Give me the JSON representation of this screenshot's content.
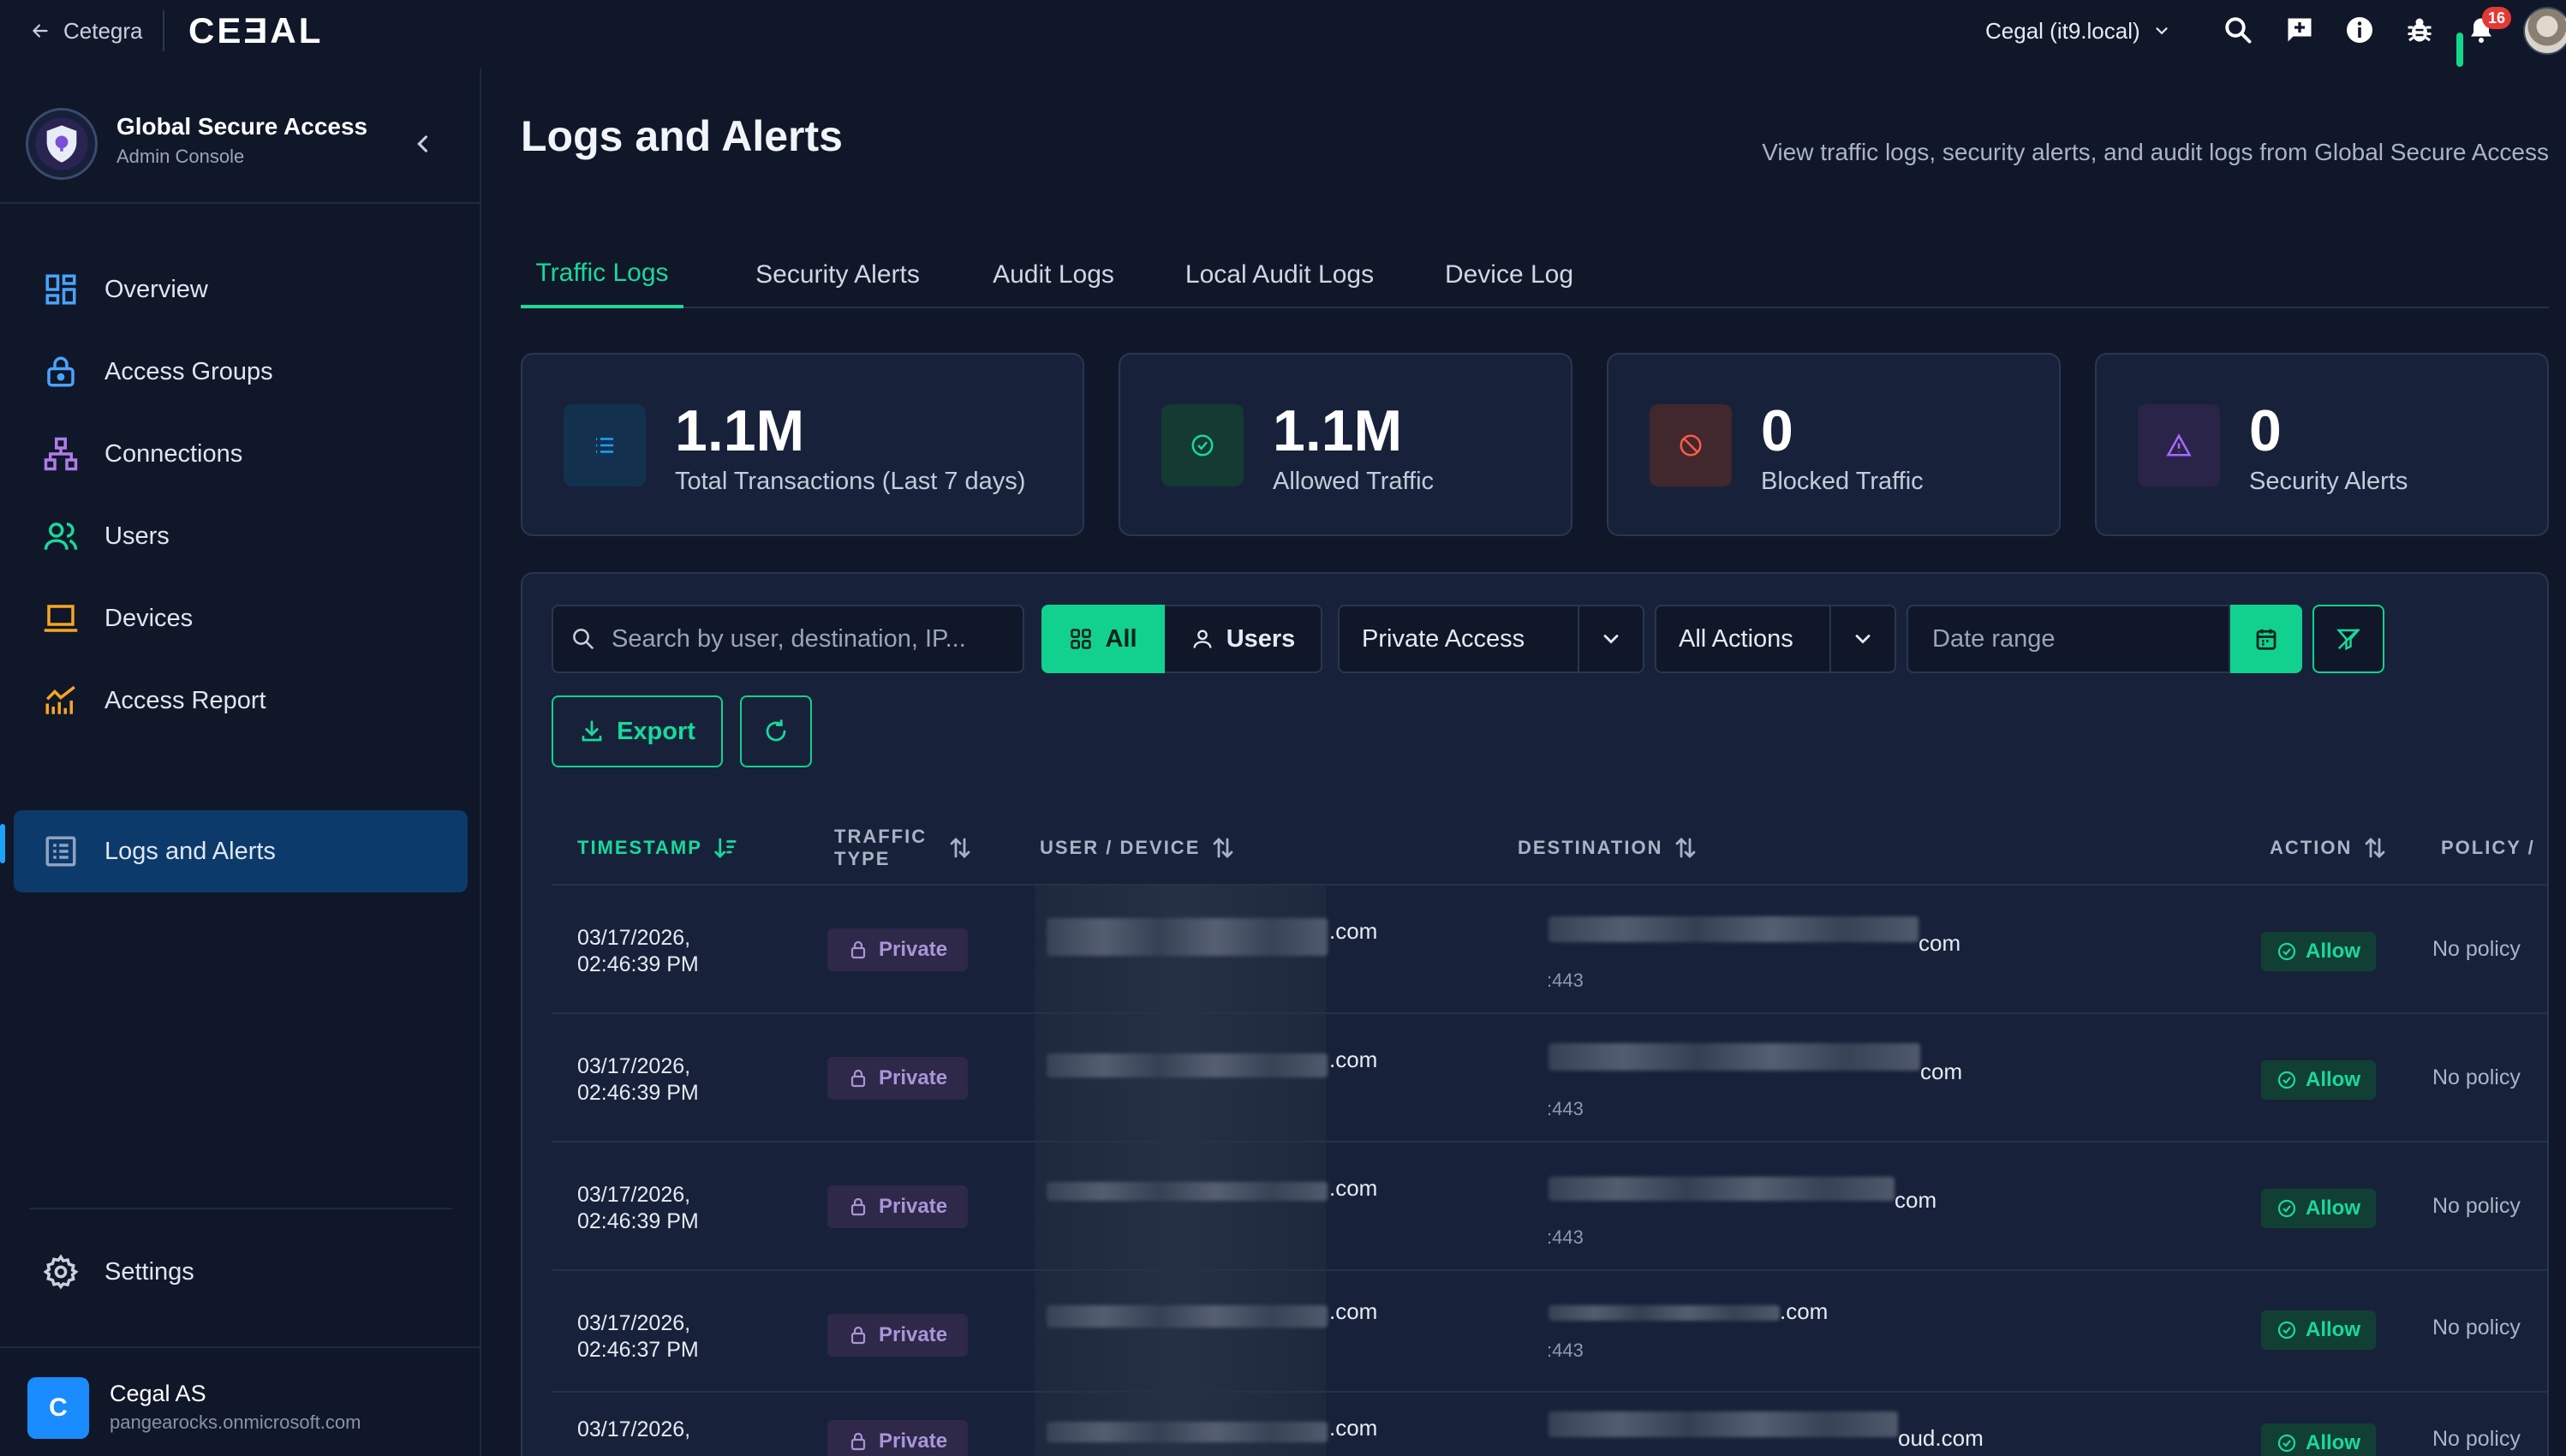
{
  "topbar": {
    "back_label": "Cetegra",
    "logo": "CEƎAL",
    "tenant": "Cegal (it9.local)",
    "notification_count": "16",
    "icons": [
      "arrow-left-icon",
      "chevron-down-icon",
      "search-icon",
      "feedback-icon",
      "info-icon",
      "bug-icon",
      "bell-icon",
      "user-avatar"
    ]
  },
  "sidebar": {
    "brand_title": "Global Secure Access",
    "brand_subtitle": "Admin Console",
    "items": [
      {
        "label": "Overview",
        "icon": "dashboard-icon",
        "color": "#4aa3ff"
      },
      {
        "label": "Access Groups",
        "icon": "lock-icon",
        "color": "#4aa3ff"
      },
      {
        "label": "Connections",
        "icon": "network-icon",
        "color": "#b07be8"
      },
      {
        "label": "Users",
        "icon": "users-icon",
        "color": "#19d99b"
      },
      {
        "label": "Devices",
        "icon": "laptop-icon",
        "color": "#f5a524"
      },
      {
        "label": "Access Report",
        "icon": "chart-icon",
        "color": "#f5a524"
      },
      {
        "label": "Logs and Alerts",
        "icon": "list-icon",
        "color": "#8fa2c0",
        "active": true
      }
    ],
    "settings_label": "Settings",
    "org_initial": "C",
    "org_name": "Cegal AS",
    "org_domain": "pangearocks.onmicrosoft.com"
  },
  "page": {
    "title": "Logs and Alerts",
    "description": "View traffic logs, security alerts, and audit logs from Global Secure Access"
  },
  "tabs": [
    {
      "label": "Traffic Logs",
      "active": true
    },
    {
      "label": "Security Alerts"
    },
    {
      "label": "Audit Logs"
    },
    {
      "label": "Local Audit Logs"
    },
    {
      "label": "Device Log"
    }
  ],
  "stats": [
    {
      "value": "1.1M",
      "label": "Total Transactions (Last 7 days)",
      "icon": "list-icon",
      "accent": "#1da1ff"
    },
    {
      "value": "1.1M",
      "label": "Allowed Traffic",
      "icon": "check-circle-icon",
      "accent": "#19d99b"
    },
    {
      "value": "0",
      "label": "Blocked Traffic",
      "icon": "block-icon",
      "accent": "#ff5a4a"
    },
    {
      "value": "0",
      "label": "Security Alerts",
      "icon": "warning-icon",
      "accent": "#a56bff"
    }
  ],
  "filters": {
    "search_placeholder": "Search by user, destination, IP...",
    "seg_all": "All",
    "seg_users": "Users",
    "traffic_select": "Private Access",
    "action_select": "All Actions",
    "date_placeholder": "Date range",
    "export_label": "Export"
  },
  "table": {
    "headers": {
      "timestamp": "TIMESTAMP",
      "traffic_type": "TRAFFIC TYPE",
      "user_device": "USER / DEVICE",
      "destination": "DESTINATION",
      "action": "ACTION",
      "policy": "POLICY /"
    },
    "rows": [
      {
        "date": "03/17/2026,",
        "time": "02:46:39 PM",
        "type": "Private",
        "user_suffix": ".com",
        "dest_suffix": "com",
        "port": ":443",
        "action": "Allow",
        "policy": "No policy"
      },
      {
        "date": "03/17/2026,",
        "time": "02:46:39 PM",
        "type": "Private",
        "user_suffix": ".com",
        "dest_suffix": "com",
        "port": ":443",
        "action": "Allow",
        "policy": "No policy"
      },
      {
        "date": "03/17/2026,",
        "time": "02:46:39 PM",
        "type": "Private",
        "user_suffix": ".com",
        "dest_suffix": "com",
        "port": ":443",
        "action": "Allow",
        "policy": "No policy"
      },
      {
        "date": "03/17/2026,",
        "time": "02:46:37 PM",
        "type": "Private",
        "user_suffix": ".com",
        "dest_suffix": ".com",
        "port": ":443",
        "action": "Allow",
        "policy": "No policy"
      },
      {
        "date": "03/17/2026,",
        "time": "",
        "type": "Private",
        "user_suffix": ".com",
        "dest_suffix": "oud.com",
        "port": "",
        "action": "Allow",
        "policy": "No policy"
      }
    ]
  }
}
